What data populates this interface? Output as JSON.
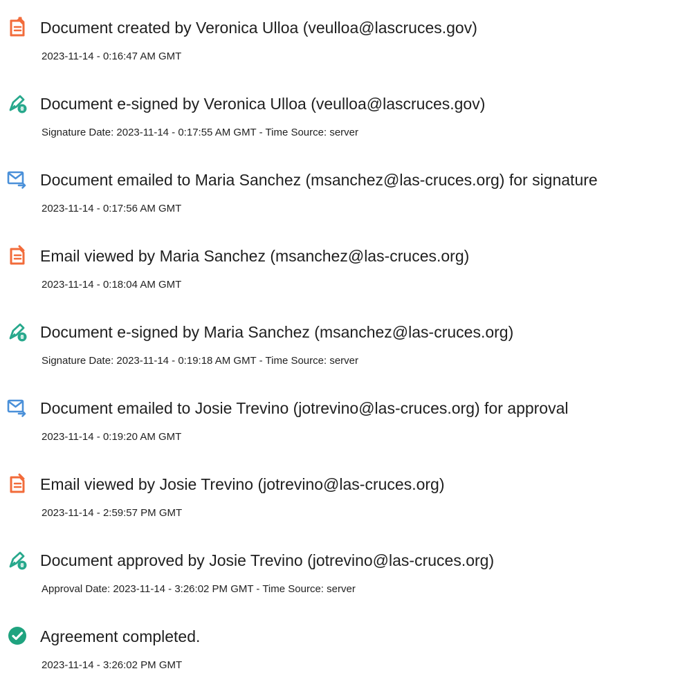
{
  "events": [
    {
      "icon": "document-icon",
      "title": "Document created by Veronica Ulloa (veulloa@lascruces.gov)",
      "detail": "2023-11-14 - 0:16:47 AM GMT"
    },
    {
      "icon": "e-sign-pen-icon",
      "title": "Document e-signed by Veronica Ulloa (veulloa@lascruces.gov)",
      "detail": "Signature Date: 2023-11-14 - 0:17:55 AM GMT - Time Source: server"
    },
    {
      "icon": "email-sent-icon",
      "title": "Document emailed to Maria Sanchez (msanchez@las-cruces.org) for signature",
      "detail": "2023-11-14 - 0:17:56 AM GMT"
    },
    {
      "icon": "document-icon",
      "title": "Email viewed by Maria Sanchez (msanchez@las-cruces.org)",
      "detail": "2023-11-14 - 0:18:04 AM GMT"
    },
    {
      "icon": "e-sign-pen-icon",
      "title": "Document e-signed by Maria Sanchez (msanchez@las-cruces.org)",
      "detail": "Signature Date: 2023-11-14 - 0:19:18 AM GMT - Time Source: server"
    },
    {
      "icon": "email-sent-icon",
      "title": "Document emailed to Josie Trevino (jotrevino@las-cruces.org) for approval",
      "detail": "2023-11-14 - 0:19:20 AM GMT"
    },
    {
      "icon": "document-icon",
      "title": "Email viewed by Josie Trevino (jotrevino@las-cruces.org)",
      "detail": "2023-11-14 - 2:59:57 PM GMT"
    },
    {
      "icon": "e-sign-pen-icon",
      "title": "Document approved by Josie Trevino (jotrevino@las-cruces.org)",
      "detail": "Approval Date: 2023-11-14 - 3:26:02 PM GMT - Time Source: server"
    },
    {
      "icon": "check-circle-icon",
      "title": "Agreement completed.",
      "detail": "2023-11-14 - 3:26:02 PM GMT"
    }
  ],
  "colors": {
    "document_icon": "#F26B3A",
    "pen_icon": "#27A88C",
    "email_icon": "#4A90D9",
    "check_icon": "#1FA37F",
    "text": "#222222"
  }
}
